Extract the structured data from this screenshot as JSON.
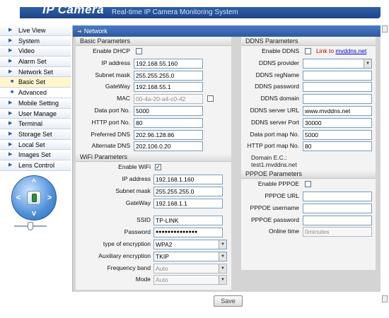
{
  "header": {
    "brand": "IP Camera",
    "tagline": "Real-time IP Camera Monitoring System"
  },
  "sidebar": {
    "items": [
      {
        "label": "Live View",
        "kind": "main"
      },
      {
        "label": "System",
        "kind": "main"
      },
      {
        "label": "Video",
        "kind": "main"
      },
      {
        "label": "Alarm Set",
        "kind": "main"
      },
      {
        "label": "Network Set",
        "kind": "main"
      },
      {
        "label": "Basic Set",
        "kind": "sub",
        "active": true
      },
      {
        "label": "Advanced",
        "kind": "sub"
      },
      {
        "label": "Mobile Setting",
        "kind": "main"
      },
      {
        "label": "User Manage",
        "kind": "main"
      },
      {
        "label": "Terminal",
        "kind": "main"
      },
      {
        "label": "Storage Set",
        "kind": "main"
      },
      {
        "label": "Local Set",
        "kind": "main"
      },
      {
        "label": "Images Set",
        "kind": "main"
      },
      {
        "label": "Lens Control",
        "kind": "main"
      }
    ],
    "ptz": {
      "up": "^",
      "down": "v",
      "left": "<",
      "right": ">"
    },
    "zoom_level": 0.5
  },
  "main": {
    "title": "Network",
    "basic": {
      "title": "Basic Parameters",
      "enable_dhcp": {
        "label": "Enable DHCP",
        "checked": false
      },
      "ip_address": {
        "label": "IP address",
        "value": "192.168.55.160"
      },
      "subnet_mask": {
        "label": "Subnet mask",
        "value": "255.255.255.0"
      },
      "gateway": {
        "label": "GateWay",
        "value": "192.168.55.1"
      },
      "mac": {
        "label": "MAC",
        "value": "00-4a-20-a4-c0-42"
      },
      "data_port": {
        "label": "Data port No.",
        "value": "5000"
      },
      "http_port": {
        "label": "HTTP port No.",
        "value": "80"
      },
      "preferred_dns": {
        "label": "Preferred DNS",
        "value": "202.96.128.86"
      },
      "alternate_dns": {
        "label": "Alternate DNS",
        "value": "202.106.0.20"
      }
    },
    "wifi": {
      "title": "WiFi Parameters",
      "enable_wifi": {
        "label": "Enable WiFi",
        "checked": true
      },
      "ip_address": {
        "label": "IP address",
        "value": "192.168.1.160"
      },
      "subnet_mask": {
        "label": "Subnet mask",
        "value": "255.255.255.0"
      },
      "gateway": {
        "label": "GateWay",
        "value": "192.168.1.1"
      },
      "ssid": {
        "label": "SSID",
        "value": "TP-LINK"
      },
      "password": {
        "label": "Password",
        "value": "●●●●●●●●●●●●●●"
      },
      "encryption": {
        "label": "type of encryption",
        "value": "WPA2"
      },
      "aux_encryption": {
        "label": "Auxiliary encryption",
        "value": "TKIP"
      },
      "frequency_band": {
        "label": "Frequency band",
        "value": "Auto"
      },
      "mode": {
        "label": "Mode",
        "value": "Auto"
      }
    },
    "ddns": {
      "title": "DDNS Parameters",
      "enable_ddns": {
        "label": "Enable DDNS",
        "checked": false
      },
      "link_text": "Link to",
      "link_url": "mvddns.net",
      "provider": {
        "label": "DDNS provider",
        "value": ""
      },
      "reg_name": {
        "label": "DDNS regName",
        "value": ""
      },
      "password": {
        "label": "DDNS password",
        "value": ""
      },
      "domain": {
        "label": "DDNS domain",
        "value": ""
      },
      "server_url": {
        "label": "DDNS server URL",
        "value": "www.mvddns.net"
      },
      "server_port": {
        "label": "DDNS server Port",
        "value": "30000"
      },
      "data_port_map": {
        "label": "Data port map No.",
        "value": "5000"
      },
      "http_port_map": {
        "label": "HTTP port map No.",
        "value": "80"
      },
      "domain_example_label": "Domain E.C.:",
      "domain_example_value": "test1.mvddns.net"
    },
    "pppoe": {
      "title": "PPPOE Parameters",
      "enable_pppoe": {
        "label": "Enable PPPOE",
        "checked": false
      },
      "url": {
        "label": "PPPOE URL",
        "value": ""
      },
      "username": {
        "label": "PPPOE username",
        "value": ""
      },
      "password": {
        "label": "PPPOE password",
        "value": ""
      },
      "online_time": {
        "label": "Online time",
        "value": "0minutes"
      }
    },
    "save_label": "Save"
  }
}
